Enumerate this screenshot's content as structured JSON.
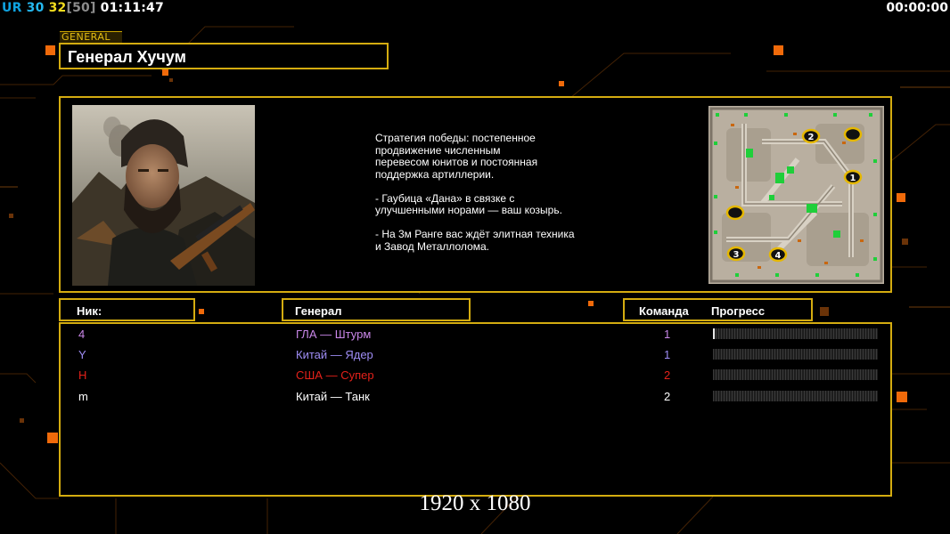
{
  "hud": {
    "ur_label": "UR",
    "stat1": "30",
    "stat2": "32",
    "stat3": "[50]",
    "clock": "01:11:47",
    "timer": "00:00:00"
  },
  "general_tag": "GENERAL",
  "general_name": "Генерал Хучум",
  "description": {
    "line1": "Стратегия победы: постепенное",
    "line2": "продвижение численным",
    "line3": "перевесом юнитов и постоянная",
    "line4": "поддержка артиллерии.",
    "line5": "- Гаубица «Дана» в связке с",
    "line6": "улучшенными норами — ваш козырь.",
    "line7": "- На 3м Ранге вас ждёт элитная техника",
    "line8": "и Завод Металлолома."
  },
  "minimap": {
    "start_positions": [
      "1",
      "2",
      "3",
      "4"
    ]
  },
  "headers": {
    "nick": "Ник:",
    "general": "Генерал",
    "team": "Команда",
    "progress": "Прогресс"
  },
  "players": [
    {
      "nick": "4",
      "general": "ГЛА — Штурм",
      "team": "1",
      "color": "#c987e8",
      "progress": 0.01
    },
    {
      "nick": "Y",
      "general": "Китай — Ядер",
      "team": "1",
      "color": "#9f8df5",
      "progress": 0
    },
    {
      "nick": "H",
      "general": "США — Супер",
      "team": "2",
      "color": "#e3211a",
      "progress": 0
    },
    {
      "nick": "m",
      "general": "Китай — Танк",
      "team": "2",
      "color": "#ffffff",
      "progress": 0
    }
  ],
  "resolution": "1920 x 1080",
  "colors": {
    "accent": "#d4ac10",
    "ur": "#0fa3e0",
    "stat1": "#25b8ef",
    "stat2": "#f2dc1e",
    "stat3": "#8c8c8c"
  }
}
